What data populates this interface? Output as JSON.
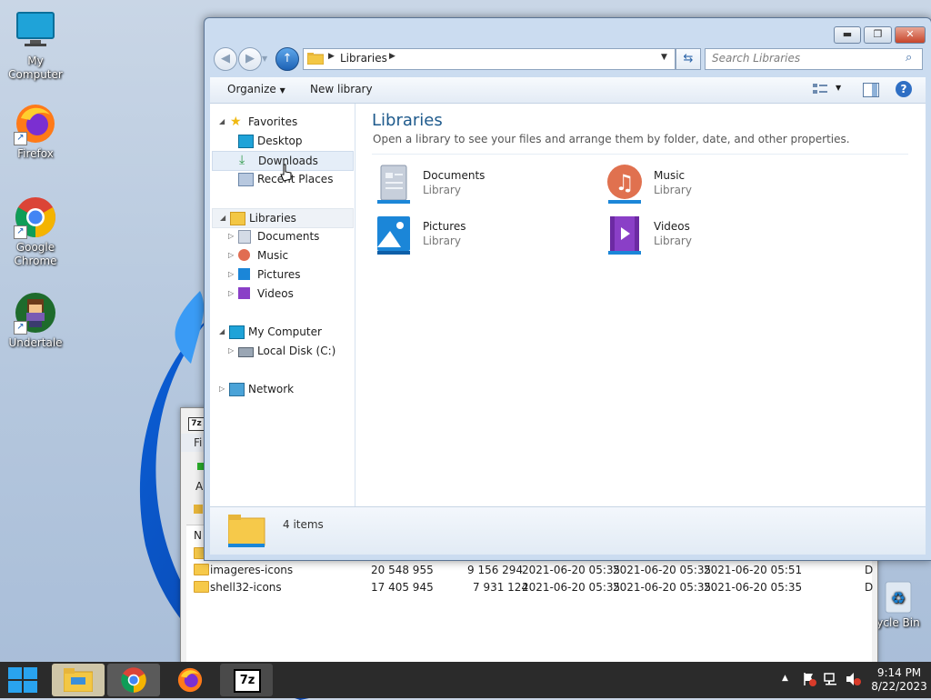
{
  "desktop": {
    "icons": [
      {
        "label": "My Computer"
      },
      {
        "label": "Firefox"
      },
      {
        "label": "Google Chrome"
      },
      {
        "label": "Undertale"
      },
      {
        "label": "ycle Bin"
      }
    ]
  },
  "zip_window": {
    "app_badge": "7z",
    "menu_fragment": "Fi",
    "toolbar_fragment": "A",
    "column_fragment": "N",
    "rows": [
      {
        "name": "imageres-icons",
        "size": "20 548 955",
        "packed": "9 156 294",
        "modified": "2021-06-20 05:35",
        "created": "2021-06-20 05:35",
        "accessed": "2021-06-20 05:51",
        "extra": "D"
      },
      {
        "name": "shell32-icons",
        "size": "17 405 945",
        "packed": "7 931 124",
        "modified": "2021-06-20 05:35",
        "created": "2021-06-20 05:35",
        "accessed": "2021-06-20 05:35",
        "extra": "D"
      }
    ]
  },
  "explorer": {
    "address": {
      "crumb": "Libraries"
    },
    "search_placeholder": "Search Libraries",
    "toolbar": {
      "organize": "Organize",
      "new_library": "New library"
    },
    "nav": {
      "favorites": "Favorites",
      "desktop": "Desktop",
      "downloads": "Downloads",
      "recent": "Recent Places",
      "libraries": "Libraries",
      "documents": "Documents",
      "music": "Music",
      "pictures": "Pictures",
      "videos": "Videos",
      "computer": "My Computer",
      "local_disk": "Local Disk (C:)",
      "network": "Network"
    },
    "content": {
      "title": "Libraries",
      "subtitle": "Open a library to see your files and arrange them by folder, date, and other properties.",
      "libraries": [
        {
          "name": "Documents",
          "type": "Library"
        },
        {
          "name": "Music",
          "type": "Library"
        },
        {
          "name": "Pictures",
          "type": "Library"
        },
        {
          "name": "Videos",
          "type": "Library"
        }
      ]
    },
    "details": {
      "count": "4 items"
    }
  },
  "taskbar": {
    "apps": [
      "Start",
      "File Explorer",
      "Google Chrome",
      "Firefox",
      "7-Zip"
    ],
    "zip_label": "7z",
    "time": "9:14 PM",
    "date": "8/22/2023"
  }
}
